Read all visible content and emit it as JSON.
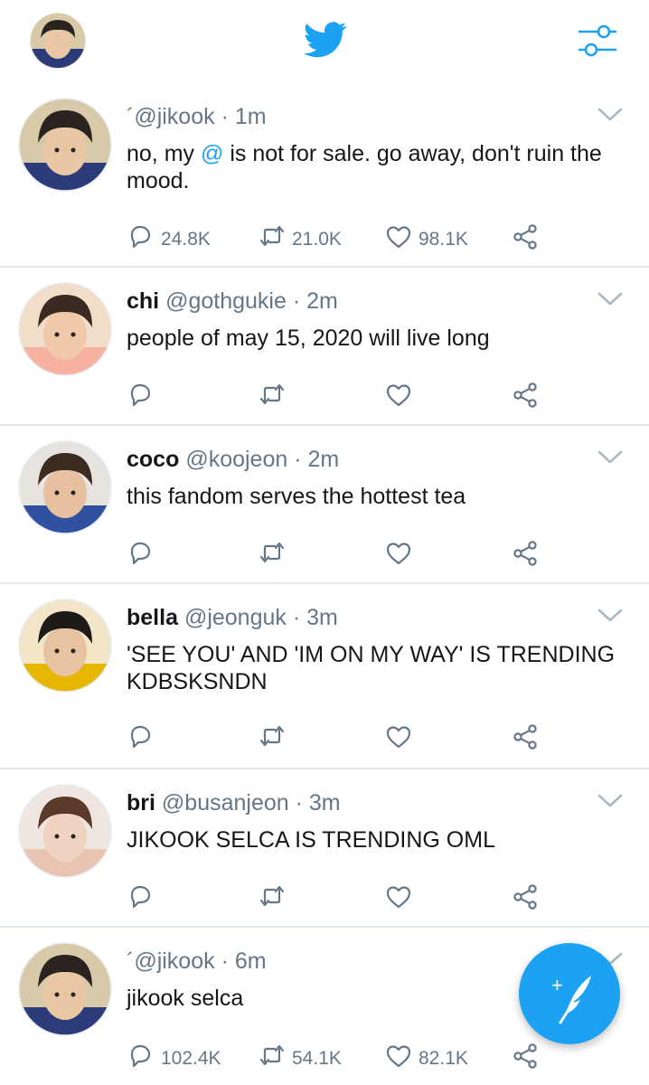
{
  "app": {
    "accent": "#1da1f2",
    "icon": "twitter-bird-icon"
  },
  "topbar": {
    "avatar_label": "profile-avatar",
    "settings_icon": "sliders-icon"
  },
  "tweets": [
    {
      "name": "",
      "handle": "´@jikook",
      "time": "1m",
      "text_before": "no, my ",
      "mention": "@",
      "text_after": " is not for sale. go away, don't ruin the mood.",
      "replies": "24.8K",
      "retweets": "21.0K",
      "likes": "98.1K",
      "avatar_colors": [
        "#d8c9a8",
        "#2a2320",
        "#e9c7a5",
        "#2c3b79"
      ]
    },
    {
      "name": "chi",
      "handle": "@gothgukie",
      "time": "2m",
      "text": "people of may 15, 2020 will live long",
      "replies": "",
      "retweets": "",
      "likes": "",
      "avatar_colors": [
        "#f2ddc8",
        "#3b2a22",
        "#f0c8aa",
        "#f6b1a0"
      ]
    },
    {
      "name": "coco",
      "handle": "@koojeon",
      "time": "2m",
      "text": "this fandom serves the hottest tea",
      "replies": "",
      "retweets": "",
      "likes": "",
      "avatar_colors": [
        "#e7e3df",
        "#3d2b22",
        "#e7c0a0",
        "#3050a0"
      ]
    },
    {
      "name": "bella",
      "handle": "@jeonguk",
      "time": "3m",
      "text": "'SEE YOU' AND 'IM ON MY WAY' IS TRENDING KDBSKSNDN",
      "replies": "",
      "retweets": "",
      "likes": "",
      "avatar_colors": [
        "#f3e6c8",
        "#1d1a18",
        "#e8c3a2",
        "#e7b600"
      ]
    },
    {
      "name": "bri",
      "handle": "@busanjeon",
      "time": "3m",
      "text": "JIKOOK SELCA IS TRENDING OML",
      "replies": "",
      "retweets": "",
      "likes": "",
      "avatar_colors": [
        "#efe6e0",
        "#5b3a2a",
        "#f1d3c1",
        "#e9c4b2"
      ]
    },
    {
      "name": "",
      "handle": "´@jikook",
      "time": "6m",
      "text": "jikook selca",
      "replies": "102.4K",
      "retweets": "54.1K",
      "likes": "82.1K",
      "avatar_colors": [
        "#d8c9a8",
        "#2a2320",
        "#e9c7a5",
        "#2c3b79"
      ]
    }
  ],
  "fab": {
    "icon": "compose-tweet-icon",
    "plus": "+"
  }
}
